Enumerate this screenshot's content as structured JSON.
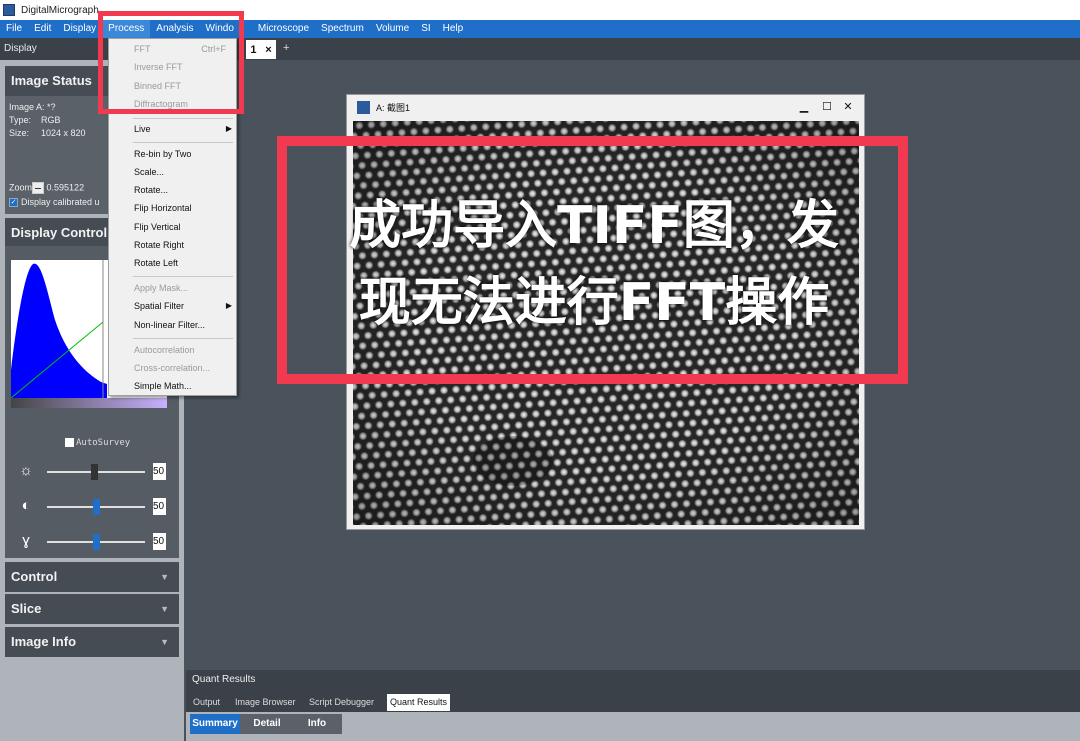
{
  "app": {
    "title": "DigitalMicrograph"
  },
  "menubar": [
    "File",
    "Edit",
    "Display",
    "Process",
    "Analysis",
    "Windo",
    "Microscope",
    "Spectrum",
    "Volume",
    "SI",
    "Help"
  ],
  "toolbar": {
    "label": "Display",
    "doc_tab": "1",
    "doc_tab_close": "×",
    "new_tab": "+"
  },
  "process_menu": {
    "items": [
      {
        "label": "FFT",
        "shortcut": "Ctrl+F",
        "enabled": false
      },
      {
        "label": "Inverse FFT",
        "enabled": false
      },
      {
        "label": "Binned FFT",
        "enabled": false
      },
      {
        "label": "Diffractogram",
        "enabled": false
      },
      {
        "label": "Live",
        "enabled": true,
        "submenu": true
      },
      {
        "label": "Re-bin by Two",
        "enabled": true
      },
      {
        "label": "Scale...",
        "enabled": true
      },
      {
        "label": "Rotate...",
        "enabled": true
      },
      {
        "label": "Flip Horizontal",
        "enabled": true
      },
      {
        "label": "Flip Vertical",
        "enabled": true
      },
      {
        "label": "Rotate Right",
        "enabled": true
      },
      {
        "label": "Rotate Left",
        "enabled": true
      },
      {
        "label": "Apply Mask...",
        "enabled": false
      },
      {
        "label": "Spatial Filter",
        "enabled": true,
        "submenu": true
      },
      {
        "label": "Non-linear Filter...",
        "enabled": true
      },
      {
        "label": "Autocorrelation",
        "enabled": false
      },
      {
        "label": "Cross-correlation...",
        "enabled": false
      },
      {
        "label": "Simple Math...",
        "enabled": true
      }
    ]
  },
  "left_panel": {
    "image_status": {
      "title": "Image Status",
      "image_label": "Image A: *?",
      "type_key": "Type:",
      "type_val": "RGB",
      "size_key": "Size:",
      "size_val": "1024 x 820",
      "zoom_key": "Zoom",
      "zoom_val": "0.595122",
      "display_calibrated": "Display calibrated u"
    },
    "display_control": {
      "title": "Display Control",
      "autosurvey": "AutoSurvey",
      "brightness": {
        "icon": "brightness-icon",
        "value": "50",
        "level": 0.48
      },
      "contrast": {
        "icon": "contrast-icon",
        "value": "50",
        "level": 0.5
      },
      "gamma": {
        "icon": "gamma-icon",
        "value": "50",
        "level": 0.5
      }
    },
    "sections": [
      "Control",
      "Slice",
      "Image Info"
    ]
  },
  "image_window": {
    "title": "A: 截图1",
    "minimize": "▁",
    "maximize": "☐",
    "close": "✕"
  },
  "annotation": {
    "line1": "成功导入TIFF图，发",
    "line2": "现无法进行FFT操作",
    "color": "#f13a50"
  },
  "bottom_panel": {
    "title": "Quant Results",
    "tabs": [
      "Output",
      "Image Browser",
      "Script Debugger",
      "Quant Results"
    ],
    "active_tab": "Quant Results",
    "subtabs": [
      "Summary",
      "Detail",
      "Info"
    ],
    "active_subtab": "Summary"
  },
  "colors": {
    "menubar": "#1f6fc8",
    "panel_dark": "#454c53",
    "workspace": "#4a535c",
    "histogram": "#0000ff"
  }
}
